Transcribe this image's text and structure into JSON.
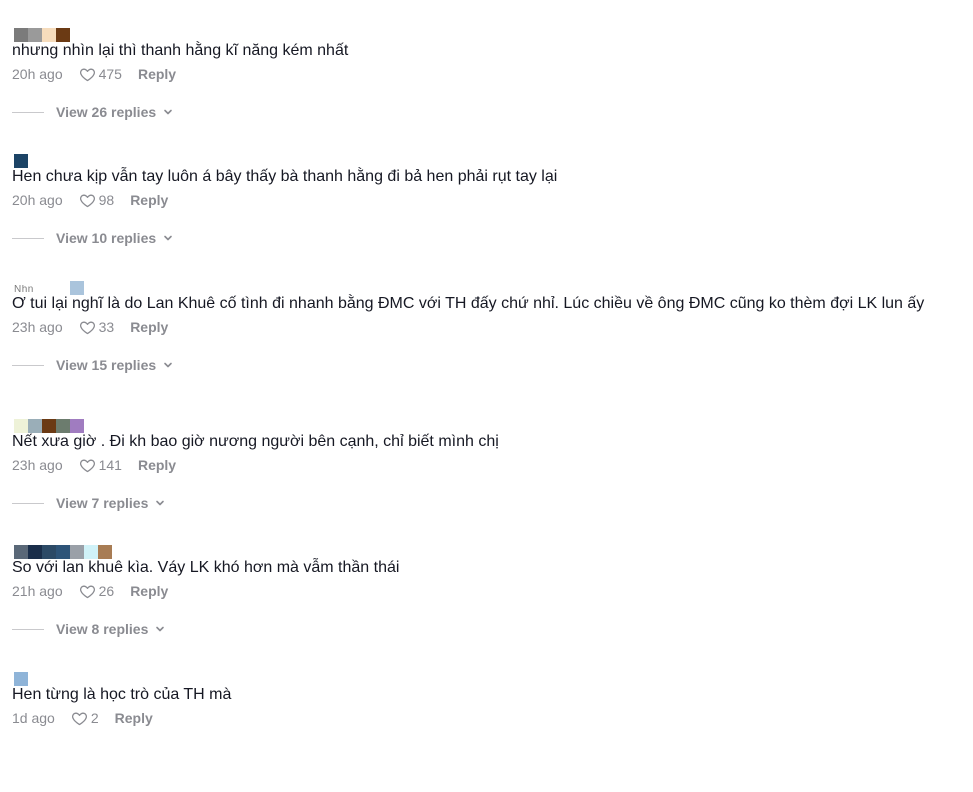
{
  "comments": [
    {
      "avatar_colors": [
        "#7b7b7b",
        "#9a9a9a",
        "#f6dcbc",
        "#6b3a14"
      ],
      "username_fragment": "",
      "text": "nhưng nhìn lại thì thanh hằng kĩ năng kém nhất",
      "time": "20h ago",
      "likes": "475",
      "reply_label": "Reply",
      "view_replies": "View 26 replies"
    },
    {
      "avatar_colors": [
        "#1c4466"
      ],
      "username_fragment": "",
      "text": "Hen chưa kịp vẫn tay luôn á bây thấy bà thanh hằng đi bả hen phải rụt tay lại",
      "time": "20h ago",
      "likes": "98",
      "reply_label": "Reply",
      "view_replies": "View 10 replies"
    },
    {
      "avatar_colors": [
        "#ffffff",
        "#ffffff",
        "#ffffff",
        "#ffffff",
        "#aac4dc"
      ],
      "username_fragment": "Nhn",
      "text": "Ơ tui lại nghĩ là do Lan Khuê cố tình đi nhanh bằng ĐMC với TH đấy chứ nhỉ. Lúc chiều về ông ĐMC cũng ko thèm đợi LK lun ấy",
      "time": "23h ago",
      "likes": "33",
      "reply_label": "Reply",
      "view_replies": "View 15 replies"
    },
    {
      "avatar_colors": [
        "#eef2d8",
        "#9aaeb8",
        "#6b3a14",
        "#6c7c6e",
        "#a07cc0"
      ],
      "username_fragment": "",
      "text": "Nết xưa giờ . Đi kh bao giờ nương người bên cạnh, chỉ biết mình chị",
      "time": "23h ago",
      "likes": "141",
      "reply_label": "Reply",
      "view_replies": "View 7 replies"
    },
    {
      "avatar_colors": [
        "#5a6878",
        "#1a2e4a",
        "#2c4a66",
        "#2e5478",
        "#9aa0a8",
        "#d0f2f8",
        "#a87c54"
      ],
      "username_fragment": "",
      "text": "So với lan khuê kìa. Váy LK khó hơn mà vẫm thần thái",
      "time": "21h ago",
      "likes": "26",
      "reply_label": "Reply",
      "view_replies": "View 8 replies"
    },
    {
      "avatar_colors": [
        "#8fb4d8"
      ],
      "username_fragment": "",
      "text": "Hen từng là học trò của TH mà",
      "time": "1d ago",
      "likes": "2",
      "reply_label": "Reply",
      "view_replies": ""
    }
  ]
}
